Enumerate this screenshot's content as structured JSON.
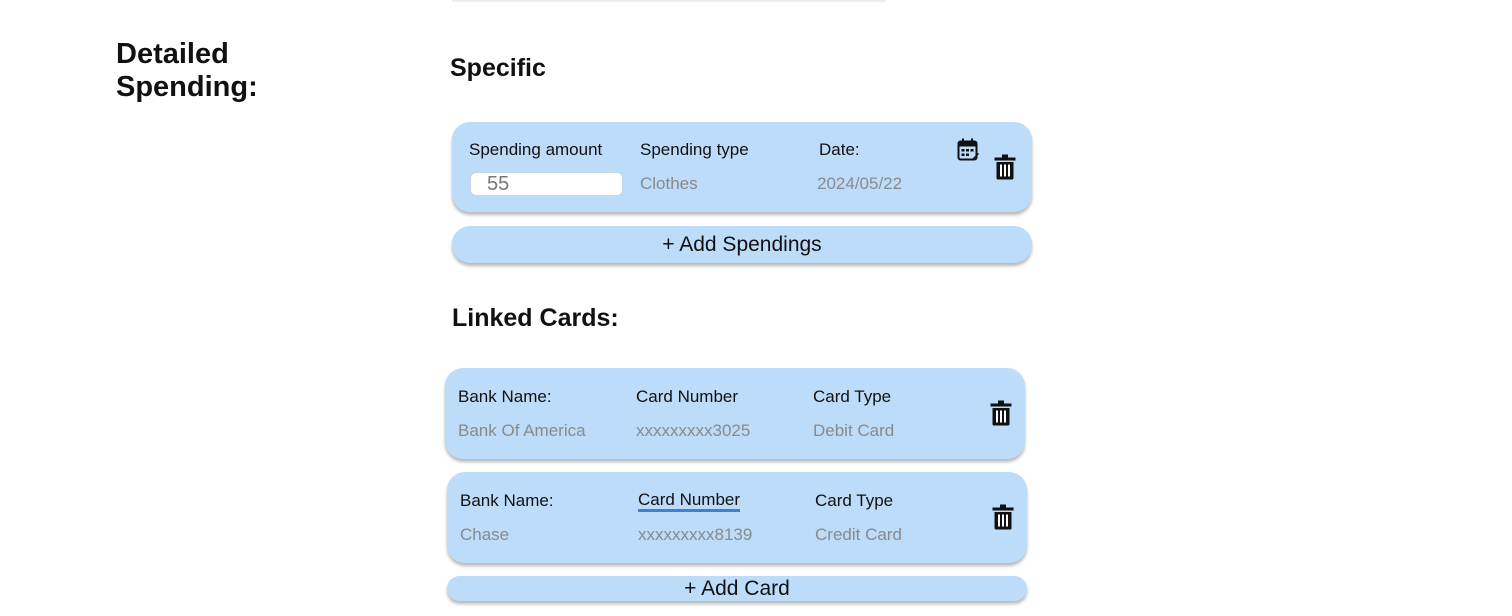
{
  "header": {
    "section_title_line1": "Detailed",
    "section_title_line2": "Spending:"
  },
  "specific": {
    "title": "Specific",
    "spending_item": {
      "amount_label": "Spending amount",
      "amount_value": "55",
      "type_label": "Spending type",
      "type_value": "Clothes",
      "date_label": "Date:",
      "date_value": "2024/05/22"
    },
    "add_label": "+ Add Spendings"
  },
  "linked_cards": {
    "title": "Linked Cards:",
    "cards": [
      {
        "bank_label": "Bank Name:",
        "bank_value": "Bank Of America",
        "number_label": "Card Number",
        "number_value": "xxxxxxxxx3025",
        "type_label": "Card Type",
        "type_value": "Debit Card"
      },
      {
        "bank_label": "Bank Name:",
        "bank_value": "Chase",
        "number_label": "Card Number",
        "number_value": "xxxxxxxxx8139",
        "type_label": "Card Type",
        "type_value": "Credit Card"
      }
    ],
    "add_label": "+ Add Card"
  },
  "icons": {
    "calendar": "calendar-icon",
    "delete": "trash-icon"
  },
  "colors": {
    "card_bg": "#bcdcf9",
    "value_text": "#8a8a8a",
    "underline": "#3f7fd8"
  }
}
